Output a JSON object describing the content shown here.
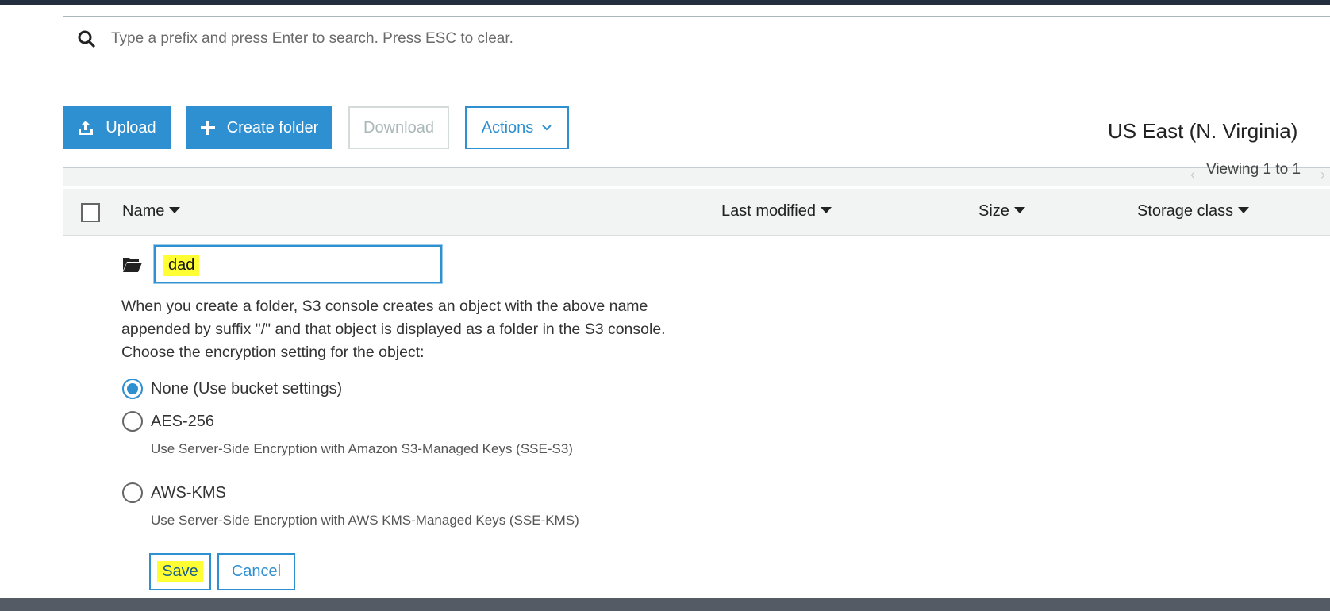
{
  "search": {
    "placeholder": "Type a prefix and press Enter to search. Press ESC to clear."
  },
  "toolbar": {
    "upload_label": "Upload",
    "create_folder_label": "Create folder",
    "download_label": "Download",
    "actions_label": "Actions"
  },
  "region": "US East (N. Virginia)",
  "pagination": {
    "viewing_text": "Viewing 1 to 1"
  },
  "table": {
    "columns": [
      "Name",
      "Last modified",
      "Size",
      "Storage class"
    ]
  },
  "new_folder": {
    "name_value": "dad",
    "description": "When you create a folder, S3 console creates an object with the above name appended by suffix \"/\" and that object is displayed as a folder in the S3 console. Choose the encryption setting for the object:",
    "encryption_options": [
      {
        "label": "None (Use bucket settings)",
        "help": "",
        "selected": true
      },
      {
        "label": "AES-256",
        "help": "Use Server-Side Encryption with Amazon S3-Managed Keys (SSE-S3)",
        "selected": false
      },
      {
        "label": "AWS-KMS",
        "help": "Use Server-Side Encryption with AWS KMS-Managed Keys (SSE-KMS)",
        "selected": false
      }
    ],
    "save_label": "Save",
    "cancel_label": "Cancel"
  },
  "colors": {
    "accent": "#2e8fd1",
    "highlight": "#ffff33",
    "topbar": "#232f3e"
  }
}
